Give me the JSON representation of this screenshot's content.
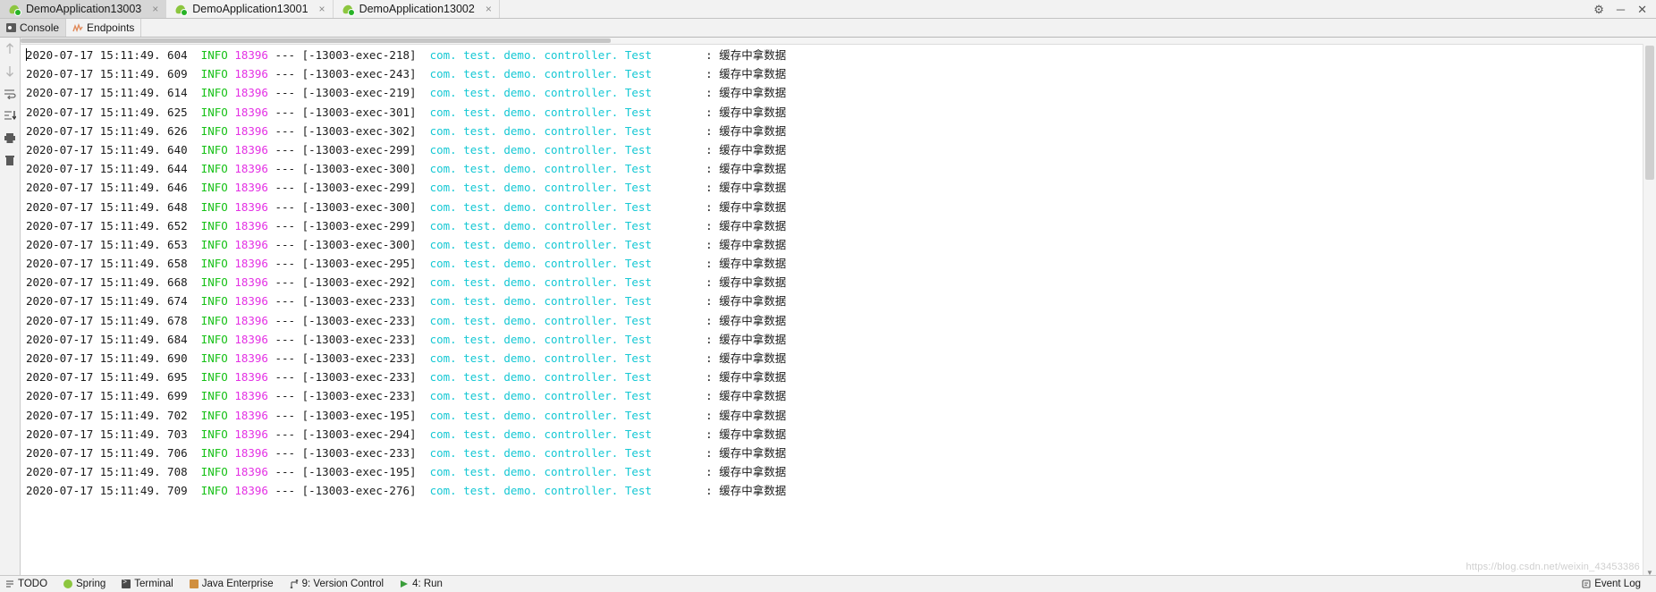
{
  "window": {
    "run_tabs": [
      {
        "label": "DemoApplication13003",
        "icon": "spring-boot-icon",
        "active": true,
        "close": "×"
      },
      {
        "label": "DemoApplication13001",
        "icon": "spring-boot-icon",
        "active": false,
        "close": "×"
      },
      {
        "label": "DemoApplication13002",
        "icon": "spring-boot-icon",
        "active": false,
        "close": "×"
      }
    ],
    "controls": {
      "settings": "⚙",
      "minimize": "─",
      "close": "✕"
    }
  },
  "subtabs": [
    {
      "label": "Console",
      "icon": "console-icon",
      "active": true
    },
    {
      "label": "Endpoints",
      "icon": "endpoints-icon",
      "active": false
    }
  ],
  "gutter": {
    "icons": [
      {
        "name": "scroll-up-icon",
        "glyph": "↑",
        "dim": true
      },
      {
        "name": "scroll-down-icon",
        "glyph": "↓",
        "dim": true
      },
      {
        "name": "soft-wrap-icon",
        "glyph": "↩",
        "dim": false
      },
      {
        "name": "scroll-to-end-icon",
        "glyph": "⇥",
        "dim": false
      },
      {
        "name": "print-icon",
        "glyph": "⎙",
        "dim": false
      },
      {
        "name": "clear-all-icon",
        "glyph": "Ὕ1",
        "dim": false
      }
    ]
  },
  "console": {
    "log_format": {
      "date": "2020-07-17",
      "level": "INFO",
      "pid": "18396",
      "dashes": "---",
      "logger": "com. test. demo. controller. Test",
      "separator": ":",
      "message": "缓存中拿数据"
    },
    "colors": {
      "level": "#17c117",
      "pid": "#e431e4",
      "logger": "#16c8d4",
      "text": "#1b1b1b"
    },
    "lines": [
      {
        "time": "15:11:49. 604",
        "thread": "[-13003-exec-218]"
      },
      {
        "time": "15:11:49. 609",
        "thread": "[-13003-exec-243]"
      },
      {
        "time": "15:11:49. 614",
        "thread": "[-13003-exec-219]"
      },
      {
        "time": "15:11:49. 625",
        "thread": "[-13003-exec-301]"
      },
      {
        "time": "15:11:49. 626",
        "thread": "[-13003-exec-302]"
      },
      {
        "time": "15:11:49. 640",
        "thread": "[-13003-exec-299]"
      },
      {
        "time": "15:11:49. 644",
        "thread": "[-13003-exec-300]"
      },
      {
        "time": "15:11:49. 646",
        "thread": "[-13003-exec-299]"
      },
      {
        "time": "15:11:49. 648",
        "thread": "[-13003-exec-300]"
      },
      {
        "time": "15:11:49. 652",
        "thread": "[-13003-exec-299]"
      },
      {
        "time": "15:11:49. 653",
        "thread": "[-13003-exec-300]"
      },
      {
        "time": "15:11:49. 658",
        "thread": "[-13003-exec-295]"
      },
      {
        "time": "15:11:49. 668",
        "thread": "[-13003-exec-292]"
      },
      {
        "time": "15:11:49. 674",
        "thread": "[-13003-exec-233]"
      },
      {
        "time": "15:11:49. 678",
        "thread": "[-13003-exec-233]"
      },
      {
        "time": "15:11:49. 684",
        "thread": "[-13003-exec-233]"
      },
      {
        "time": "15:11:49. 690",
        "thread": "[-13003-exec-233]"
      },
      {
        "time": "15:11:49. 695",
        "thread": "[-13003-exec-233]"
      },
      {
        "time": "15:11:49. 699",
        "thread": "[-13003-exec-233]"
      },
      {
        "time": "15:11:49. 702",
        "thread": "[-13003-exec-195]"
      },
      {
        "time": "15:11:49. 703",
        "thread": "[-13003-exec-294]"
      },
      {
        "time": "15:11:49. 706",
        "thread": "[-13003-exec-233]"
      },
      {
        "time": "15:11:49. 708",
        "thread": "[-13003-exec-195]"
      },
      {
        "time": "15:11:49. 709",
        "thread": "[-13003-exec-276]"
      }
    ]
  },
  "statusbar": {
    "items": [
      {
        "label": "TODO",
        "icon": "todo-icon"
      },
      {
        "label": "Spring",
        "icon": "spring-icon"
      },
      {
        "label": "Terminal",
        "icon": "terminal-icon"
      },
      {
        "label": "Java Enterprise",
        "icon": "java-enterprise-icon"
      },
      {
        "label": "9: Version Control",
        "icon": "version-control-icon"
      },
      {
        "label": "4: Run",
        "icon": "run-icon"
      }
    ],
    "right": {
      "label": "Event Log",
      "icon": "event-log-icon"
    }
  },
  "watermark": "https://blog.csdn.net/weixin_43453386"
}
